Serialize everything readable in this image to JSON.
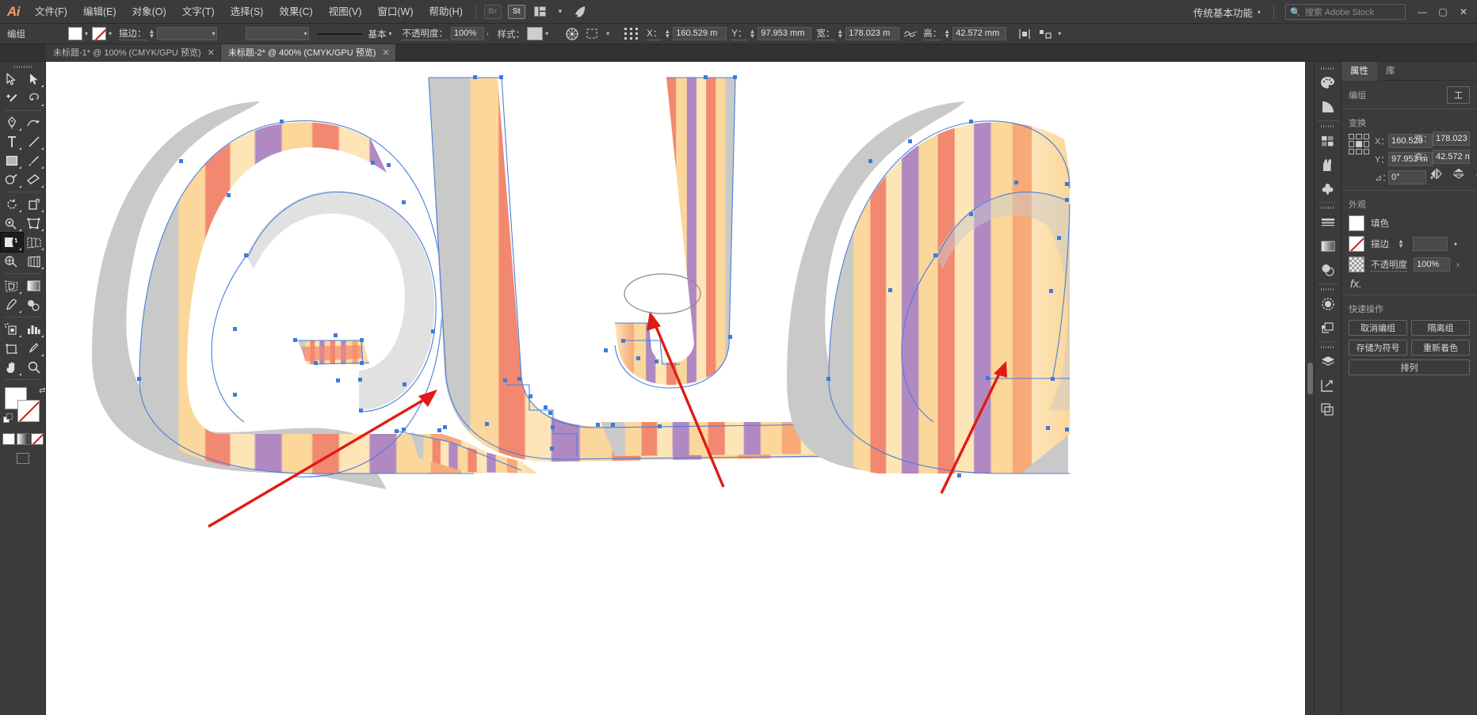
{
  "app": {
    "logo": "Ai",
    "workspace": "传统基本功能",
    "search_placeholder": "搜索 Adobe Stock"
  },
  "menu": {
    "items": [
      {
        "label": "文件(F)",
        "name": "menu-file"
      },
      {
        "label": "编辑(E)",
        "name": "menu-edit"
      },
      {
        "label": "对象(O)",
        "name": "menu-object"
      },
      {
        "label": "文字(T)",
        "name": "menu-type"
      },
      {
        "label": "选择(S)",
        "name": "menu-select"
      },
      {
        "label": "效果(C)",
        "name": "menu-effect"
      },
      {
        "label": "视图(V)",
        "name": "menu-view"
      },
      {
        "label": "窗口(W)",
        "name": "menu-window"
      },
      {
        "label": "帮助(H)",
        "name": "menu-help"
      }
    ],
    "bridge_label": "Br",
    "stock_label": "St"
  },
  "window_buttons": {
    "minimize": "—",
    "maximize": "▢",
    "close": "✕"
  },
  "controlbar": {
    "selection_label": "编组",
    "stroke_label": "描边：",
    "stroke_weight": "",
    "stroke_profile": "基本",
    "opacity_label": "不透明度：",
    "opacity_value": "100%",
    "style_label": "样式：",
    "x_label": "X：",
    "x_value": "160.529 m",
    "y_label": "Y：",
    "y_value": "97.953 mm",
    "w_label": "宽：",
    "w_value": "178.023 m",
    "h_label": "高：",
    "h_value": "42.572 mm"
  },
  "tabs": [
    {
      "label": "未标题-1* @ 100% (CMYK/GPU 预览)",
      "close": "✕",
      "active": false
    },
    {
      "label": "未标题-2* @ 400% (CMYK/GPU 预览)",
      "close": "✕",
      "active": true
    }
  ],
  "toolbar": {
    "tools": [
      {
        "name": "selection-tool"
      },
      {
        "name": "direct-selection-tool"
      },
      {
        "name": "magic-wand-tool"
      },
      {
        "name": "lasso-tool"
      },
      {
        "name": "pen-tool"
      },
      {
        "name": "curvature-tool"
      },
      {
        "name": "type-tool"
      },
      {
        "name": "line-segment-tool"
      },
      {
        "name": "rectangle-tool"
      },
      {
        "name": "paintbrush-tool"
      },
      {
        "name": "shaper-tool"
      },
      {
        "name": "eraser-tool"
      },
      {
        "name": "rotate-tool"
      },
      {
        "name": "scale-tool"
      },
      {
        "name": "width-tool"
      },
      {
        "name": "free-transform-tool"
      },
      {
        "name": "shape-builder-tool"
      },
      {
        "name": "perspective-grid-tool"
      },
      {
        "name": "mesh-tool"
      },
      {
        "name": "gradient-tool"
      },
      {
        "name": "eyedropper-tool"
      },
      {
        "name": "blend-tool"
      },
      {
        "name": "symbol-sprayer-tool"
      },
      {
        "name": "column-graph-tool"
      },
      {
        "name": "artboard-tool"
      },
      {
        "name": "slice-tool"
      },
      {
        "name": "hand-tool"
      },
      {
        "name": "zoom-tool"
      }
    ],
    "active_tool": "shape-builder-tool",
    "fill_color": "#FFFFFF",
    "stroke_color": "none"
  },
  "panel": {
    "tabs": [
      {
        "label": "属性",
        "name": "tab-properties",
        "active": true
      },
      {
        "label": "库",
        "name": "tab-libraries",
        "active": false
      }
    ],
    "selection_label": "编组",
    "tool_button": "工",
    "transform": {
      "title": "变换",
      "x_label": "X：",
      "x_value": "160.529",
      "y_label": "Y：",
      "y_value": "97.953 m",
      "w_label": "宽：",
      "w_value": "178.023",
      "h_label": "高：",
      "h_value": "42.572 m",
      "angle_label": "⊿：",
      "angle_value": "0°"
    },
    "appearance": {
      "title": "外观",
      "fill_label": "填色",
      "stroke_label": "描边",
      "stroke_weight": "",
      "opacity_label": "不透明度",
      "opacity_value": "100%",
      "fx_label": "fx."
    },
    "quick_actions": {
      "title": "快速操作",
      "buttons": [
        {
          "label": "取消编组",
          "name": "ungroup-button"
        },
        {
          "label": "隔离组",
          "name": "isolate-group-button"
        },
        {
          "label": "存储为符号",
          "name": "save-as-symbol-button"
        },
        {
          "label": "重新着色",
          "name": "recolor-button"
        },
        {
          "label": "排列",
          "name": "arrange-button"
        }
      ]
    }
  },
  "artwork": {
    "colors": {
      "stripe_orange": "#F2886F",
      "stripe_peach": "#F7A977",
      "stripe_yellow": "#FBD79B",
      "stripe_cream": "#FDE5B8",
      "stripe_purple": "#B089C2",
      "stripe_mauve": "#C79BC9",
      "shadow_gray": "#C9C9C9",
      "path_blue": "#4A7EDB",
      "anchor_blue": "#3C7BE0",
      "annotation_red": "#E01B14"
    },
    "letters": "QUO",
    "annotation_count": 3
  }
}
